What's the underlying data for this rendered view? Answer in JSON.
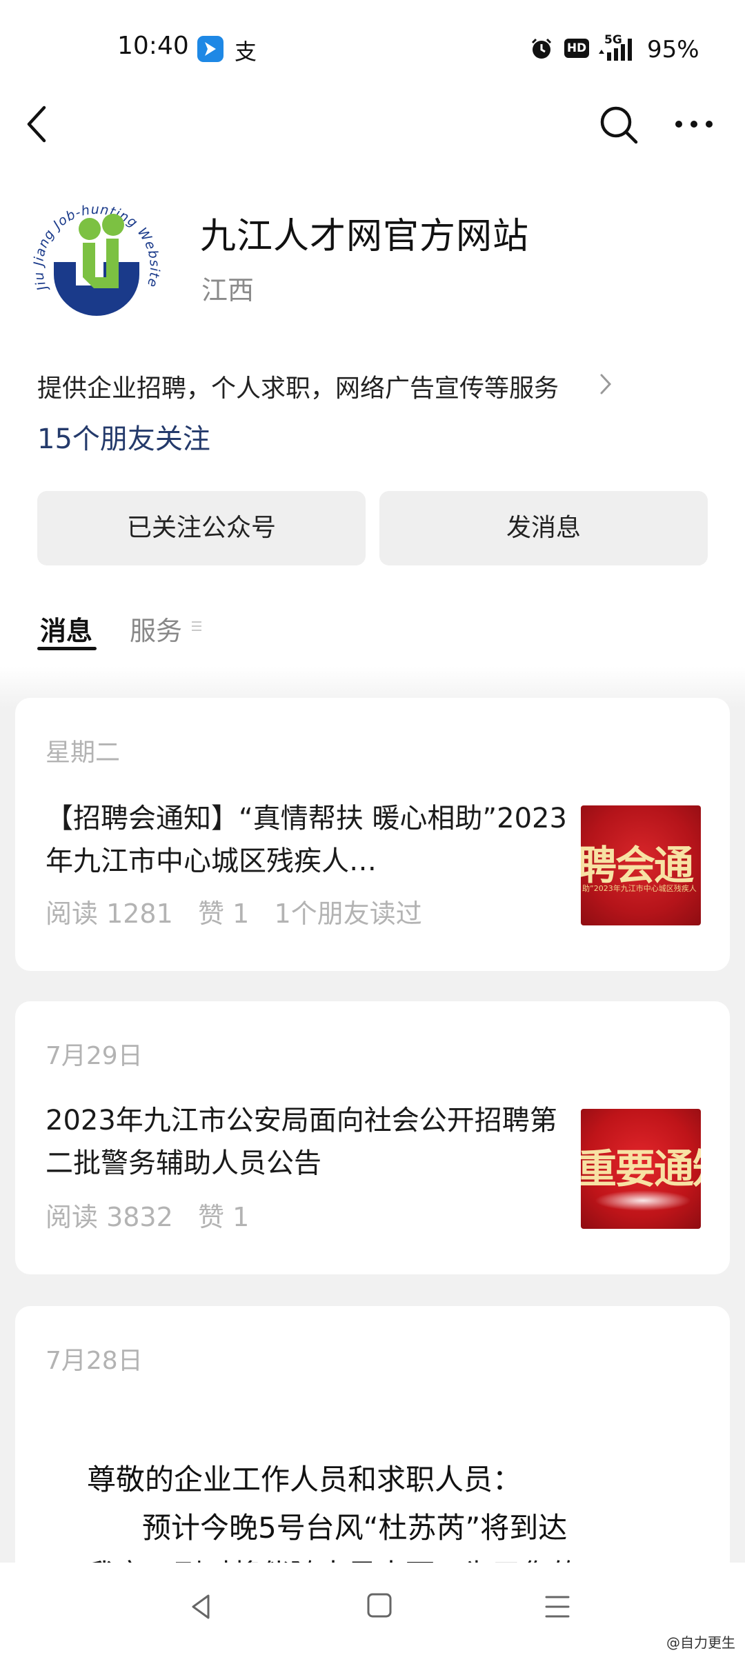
{
  "status_bar": {
    "time": "10:40",
    "app_icons": [
      "blue-arrow-app-icon",
      "alipay-icon"
    ],
    "alipay_glyph": "支",
    "hd_label": "HD",
    "network_label": "5G",
    "battery": "95%"
  },
  "nav": {
    "back_icon": "chevron-left-icon",
    "search_icon": "search-icon",
    "more_icon": "more-icon"
  },
  "profile": {
    "name": "九江人才网官方网站",
    "region": "江西",
    "description": "提供企业招聘，个人求职，网络广告宣传等服务",
    "friends_following": "15个朋友关注",
    "logo_text": "Jiu Jiang Job-hunting Website"
  },
  "actions": {
    "follow_label": "已关注公众号",
    "message_label": "发消息"
  },
  "tabs": [
    {
      "label": "消息",
      "active": true
    },
    {
      "label": "服务",
      "active": false
    }
  ],
  "articles": [
    {
      "date": "星期二",
      "title": "【招聘会通知】“真情帮扶 暖心相助”2023年九江市中心城区残疾人…",
      "reads": "阅读 1281",
      "likes": "赞 1",
      "friends_read": "1个朋友读过",
      "thumb_text": "聘会通",
      "thumb_subtext": "助”2023年九江市中心城区残疾人"
    },
    {
      "date": "7月29日",
      "title": "2023年九江市公安局面向社会公开招聘第二批警务辅助人员公告",
      "reads": "阅读 3832",
      "likes": "赞 1",
      "thumb_text": "重要通知"
    },
    {
      "date": "7月28日",
      "notice_lines": [
        "尊敬的企业工作人员和求职人员：",
        "预计今晚5号台风“杜苏芮”将到达",
        "我市，到时将伴随大风大雨，为了您的"
      ]
    }
  ],
  "colors": {
    "accent_blue": "#243a6b",
    "thumb_red": "#c0151b",
    "muted_gray": "#b3b3b3"
  },
  "watermark": "@自力更生"
}
